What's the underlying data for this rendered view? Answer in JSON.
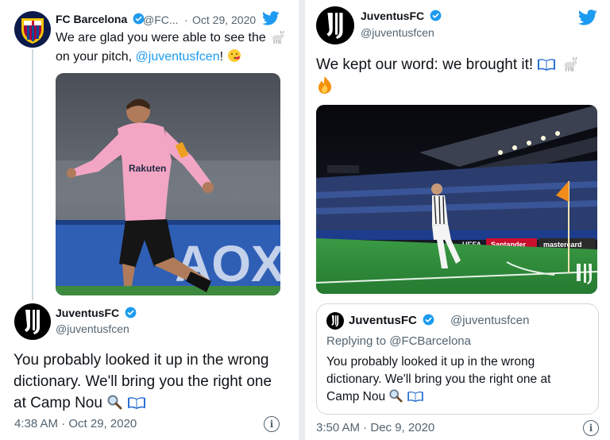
{
  "left_tweet": {
    "author_name": "FC Barcelona",
    "author_handle": "@FC...",
    "separator": "·",
    "date": "Oct 29, 2020",
    "text_line1": "We are glad you were able to see the",
    "text_line2_pre": "on your pitch,",
    "mention": "@juventusfcen",
    "text_line2_post": "!",
    "media": {
      "sponsor_text": "Rakuten",
      "banner_text": "AOX"
    },
    "reply": {
      "author_name": "JuventusFC",
      "author_handle": "@juventusfcen",
      "text_line1": "You probably looked it up in the wrong",
      "text_line2": "dictionary. We'll bring you the right one",
      "text_line3": "at Camp Nou",
      "timestamp": "4:38 AM · Oct 29, 2020",
      "info_glyph": "i"
    }
  },
  "right_tweet": {
    "author_name": "JuventusFC",
    "author_handle": "@juventusfcen",
    "text_line1": "We kept our word: we brought it!",
    "media": {
      "ad_board_1": "Santander",
      "ad_board_2": "mastercard",
      "ad_board_3": "UEFA"
    },
    "quote": {
      "author_name": "JuventusFC",
      "author_handle": "@juventusfcen",
      "replying_to": "Replying to @FCBarcelona",
      "text_line1": "You probably looked it up in the wrong",
      "text_line2": "dictionary. We'll bring you the right one at",
      "text_line3": "Camp Nou"
    },
    "timestamp": "3:50 AM · Dec 9, 2020",
    "info_glyph": "i"
  },
  "colors": {
    "twitter_blue": "#1d9bf0",
    "barca_pink": "#f3a6c4",
    "pitch_green": "#2f8a3a"
  }
}
